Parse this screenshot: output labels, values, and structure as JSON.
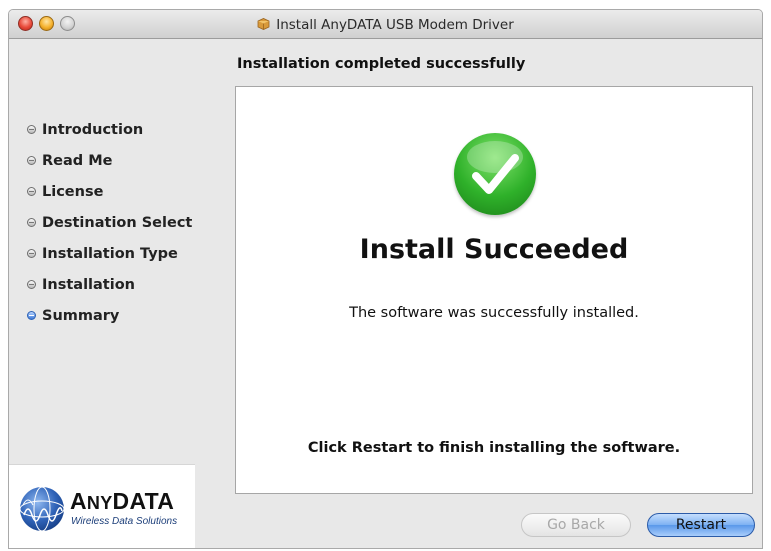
{
  "window": {
    "title": "Install AnyDATA USB Modem Driver",
    "heading": "Installation completed successfully"
  },
  "sidebar": {
    "steps": [
      {
        "label": "Introduction",
        "active": false
      },
      {
        "label": "Read Me",
        "active": false
      },
      {
        "label": "License",
        "active": false
      },
      {
        "label": "Destination Select",
        "active": false
      },
      {
        "label": "Installation Type",
        "active": false
      },
      {
        "label": "Installation",
        "active": false
      },
      {
        "label": "Summary",
        "active": true
      }
    ]
  },
  "content": {
    "status_title": "Install Succeeded",
    "status_message": "The software was successfully installed.",
    "restart_message": "Click Restart to finish installing the software."
  },
  "logo": {
    "brand_first": "A",
    "brand_small": "NY",
    "brand_rest": "DATA",
    "tagline": "Wireless Data Solutions"
  },
  "buttons": {
    "back": "Go Back",
    "restart": "Restart"
  },
  "colors": {
    "active_bullet": "#3c79d8",
    "success_green": "#2fb12a",
    "default_button": "#5a98ea"
  },
  "icons": {
    "close": "close-icon",
    "minimize": "minimize-icon",
    "zoom": "zoom-icon",
    "package": "package-icon",
    "success": "checkmark-icon",
    "logo": "globe-icon"
  }
}
